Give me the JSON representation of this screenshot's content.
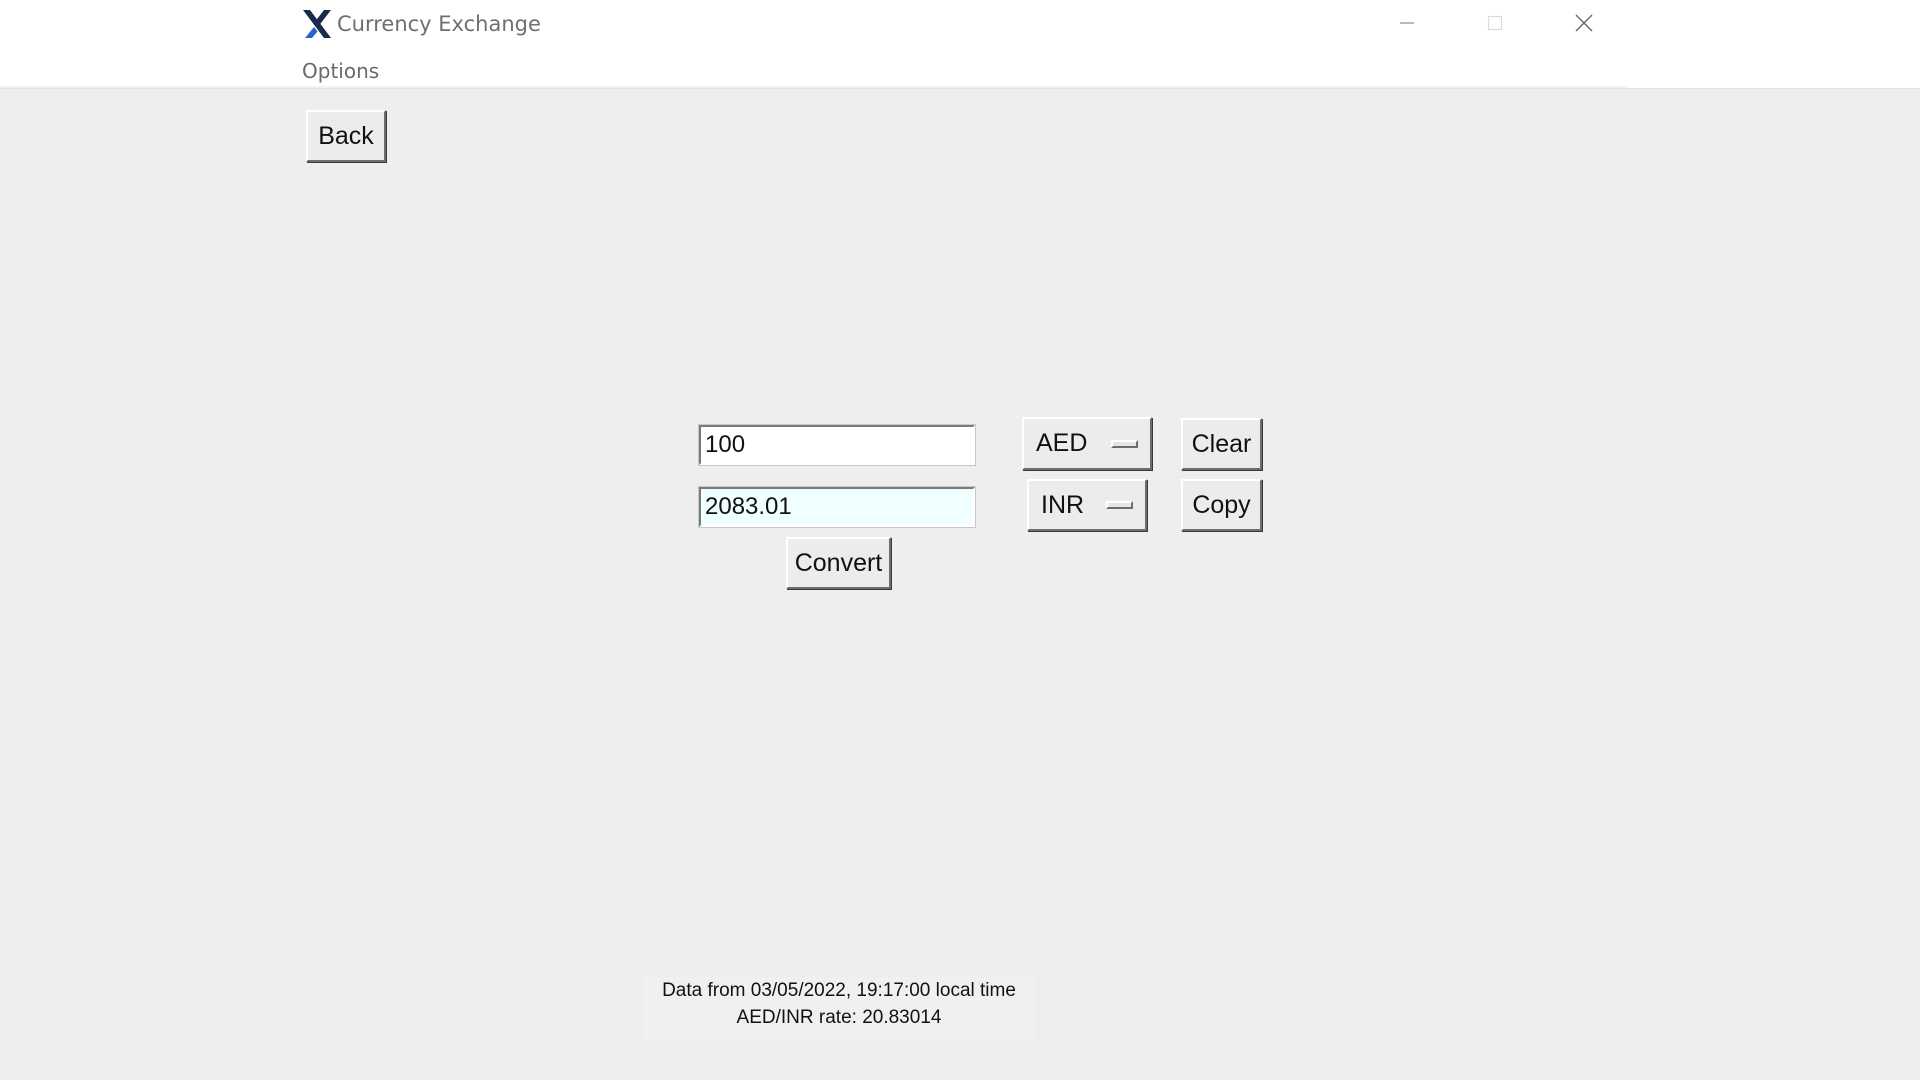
{
  "window": {
    "title": "Currency Exchange",
    "logo_icon": "x-logo-icon",
    "controls": {
      "minimize_icon": "minimize-icon",
      "maximize_icon": "maximize-icon",
      "close_icon": "close-icon"
    }
  },
  "menubar": {
    "items": [
      {
        "label": "Options"
      }
    ]
  },
  "toolbar": {
    "back_label": "Back"
  },
  "converter": {
    "amount_value": "100",
    "result_value": "2083.01",
    "from_currency": "AED",
    "to_currency": "INR",
    "convert_label": "Convert",
    "clear_label": "Clear",
    "copy_label": "Copy"
  },
  "status": {
    "data_timestamp": "Data from 03/05/2022, 19:17:00 local time",
    "rate_text": "AED/INR rate: 20.83014"
  },
  "colors": {
    "logo_dark": "#1a2a4a",
    "logo_accent": "#2a62c9",
    "result_background": "#f0ffff",
    "window_background": "#eeeeee"
  }
}
